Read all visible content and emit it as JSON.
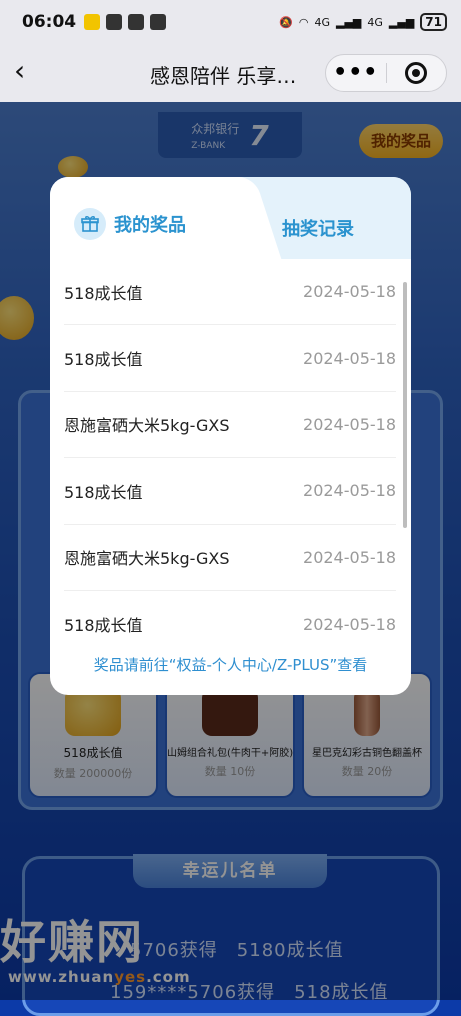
{
  "status_bar": {
    "time": "06:04",
    "signal_1": "4G",
    "signal_2": "4G",
    "battery": "71"
  },
  "nav": {
    "title": "感恩陪伴 乐享…",
    "back_icon": "‹",
    "more_icon": "•••"
  },
  "background": {
    "bank_name": "众邦银行",
    "bank_en": "Z-BANK",
    "anniversary": "7",
    "my_prize_button": "我的奖品",
    "prize_cards": [
      {
        "name": "518成长值",
        "qty": "数量 200000份"
      },
      {
        "name": "山姆组合礼包(牛肉干+阿胶)",
        "qty": "数量 10份"
      },
      {
        "name": "星巴克幻彩古铜色翻盖杯",
        "qty": "数量 20份"
      }
    ],
    "lucky_title": "幸运儿名单",
    "winners": [
      "5706获得　5180成长值",
      "159****5706获得　518成长值"
    ]
  },
  "watermark": {
    "text": "好赚网",
    "url_prefix": "www.zhuan",
    "url_mid": "yes",
    "url_suffix": ".com"
  },
  "modal": {
    "tab_my_prizes": "我的奖品",
    "tab_records": "抽奖记录",
    "records": [
      {
        "name": "518成长值",
        "date": "2024-05-18"
      },
      {
        "name": "518成长值",
        "date": "2024-05-18"
      },
      {
        "name": "恩施富硒大米5kg-GXS",
        "date": "2024-05-18"
      },
      {
        "name": "518成长值",
        "date": "2024-05-18"
      },
      {
        "name": "恩施富硒大米5kg-GXS",
        "date": "2024-05-18"
      },
      {
        "name": "518成长值",
        "date": "2024-05-18"
      }
    ],
    "footnote": "奖品请前往“权益-个人中心/Z-PLUS”查看"
  },
  "colors": {
    "accent": "#2b93cf",
    "page_bg": "#0c3aa8",
    "tab_bg": "#e4f2fb"
  }
}
